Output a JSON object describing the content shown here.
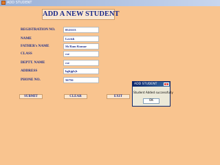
{
  "window": {
    "title": "ADD STUDENT"
  },
  "heading": "ADD A NEW STUDENT",
  "fields": [
    {
      "label": "REGISTRATION NO.",
      "value": "0521113"
    },
    {
      "label": "NAME",
      "value": "Lovish"
    },
    {
      "label": "FATHER's NAME",
      "value": "Sh Ram Kumar"
    },
    {
      "label": "CLASS",
      "value": "cse"
    },
    {
      "label": "DEPTT. NAME",
      "value": "cse"
    },
    {
      "label": "ADDRESS",
      "value": "hghjgh,h"
    },
    {
      "label": "PHONE NO.",
      "value": "56756"
    }
  ],
  "buttons": {
    "submit": "SUBMIT",
    "clear": "CLEAR",
    "exit": "EXIT"
  },
  "dialog": {
    "title": "ADD STUDENT",
    "close_glyph": "✕",
    "message": "Student Added successfully",
    "ok_label": "OK"
  },
  "colors": {
    "background": "#f9c48f",
    "label_text": "#1a2a8a",
    "heading_box": "#fbe7d0"
  }
}
